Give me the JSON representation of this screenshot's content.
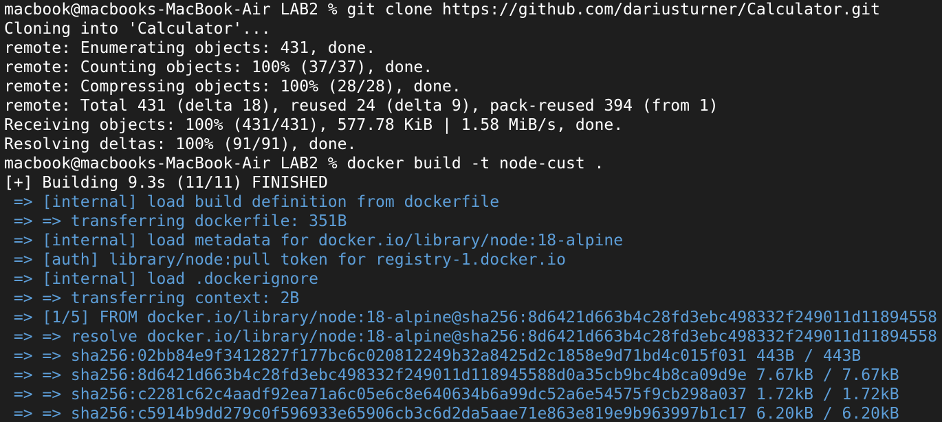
{
  "terminal": {
    "lines": [
      {
        "text": "macbook@macbooks-MacBook-Air LAB2 % git clone https://github.com/dariusturner/Calculator.git",
        "style": "plain"
      },
      {
        "text": "Cloning into 'Calculator'...",
        "style": "plain"
      },
      {
        "text": "remote: Enumerating objects: 431, done.",
        "style": "plain"
      },
      {
        "text": "remote: Counting objects: 100% (37/37), done.",
        "style": "plain"
      },
      {
        "text": "remote: Compressing objects: 100% (28/28), done.",
        "style": "plain"
      },
      {
        "text": "remote: Total 431 (delta 18), reused 24 (delta 9), pack-reused 394 (from 1)",
        "style": "plain"
      },
      {
        "text": "Receiving objects: 100% (431/431), 577.78 KiB | 1.58 MiB/s, done.",
        "style": "plain"
      },
      {
        "text": "Resolving deltas: 100% (91/91), done.",
        "style": "plain"
      },
      {
        "text": "macbook@macbooks-MacBook-Air LAB2 % docker build -t node-cust .",
        "style": "plain"
      },
      {
        "text": "[+] Building 9.3s (11/11) FINISHED",
        "style": "plain"
      },
      {
        "text": " => [internal] load build definition from dockerfile",
        "style": "blue"
      },
      {
        "text": " => => transferring dockerfile: 351B",
        "style": "blue"
      },
      {
        "text": " => [internal] load metadata for docker.io/library/node:18-alpine",
        "style": "blue"
      },
      {
        "text": " => [auth] library/node:pull token for registry-1.docker.io",
        "style": "blue"
      },
      {
        "text": " => [internal] load .dockerignore",
        "style": "blue"
      },
      {
        "text": " => => transferring context: 2B",
        "style": "blue"
      },
      {
        "text": " => [1/5] FROM docker.io/library/node:18-alpine@sha256:8d6421d663b4c28fd3ebc498332f249011d11894558",
        "style": "blue"
      },
      {
        "text": " => => resolve docker.io/library/node:18-alpine@sha256:8d6421d663b4c28fd3ebc498332f249011d11894558",
        "style": "blue"
      },
      {
        "text": " => => sha256:02bb84e9f3412827f177bc6c020812249b32a8425d2c1858e9d71bd4c015f031 443B / 443B",
        "style": "blue"
      },
      {
        "text": " => => sha256:8d6421d663b4c28fd3ebc498332f249011d118945588d0a35cb9bc4b8ca09d9e 7.67kB / 7.67kB",
        "style": "blue"
      },
      {
        "text": " => => sha256:c2281c62c4aadf92ea71a6c05e6c8e640634b6a99dc52a6e54575f9cb298a037 1.72kB / 1.72kB",
        "style": "blue"
      },
      {
        "text": " => => sha256:c5914b9dd279c0f596933e65906cb3c6d2da5aae71e863e819e9b963997b1c17 6.20kB / 6.20kB",
        "style": "blue"
      }
    ]
  },
  "colors": {
    "background": "#1e1e1e",
    "text": "#ffffff",
    "build_step": "#5d9ed8"
  }
}
